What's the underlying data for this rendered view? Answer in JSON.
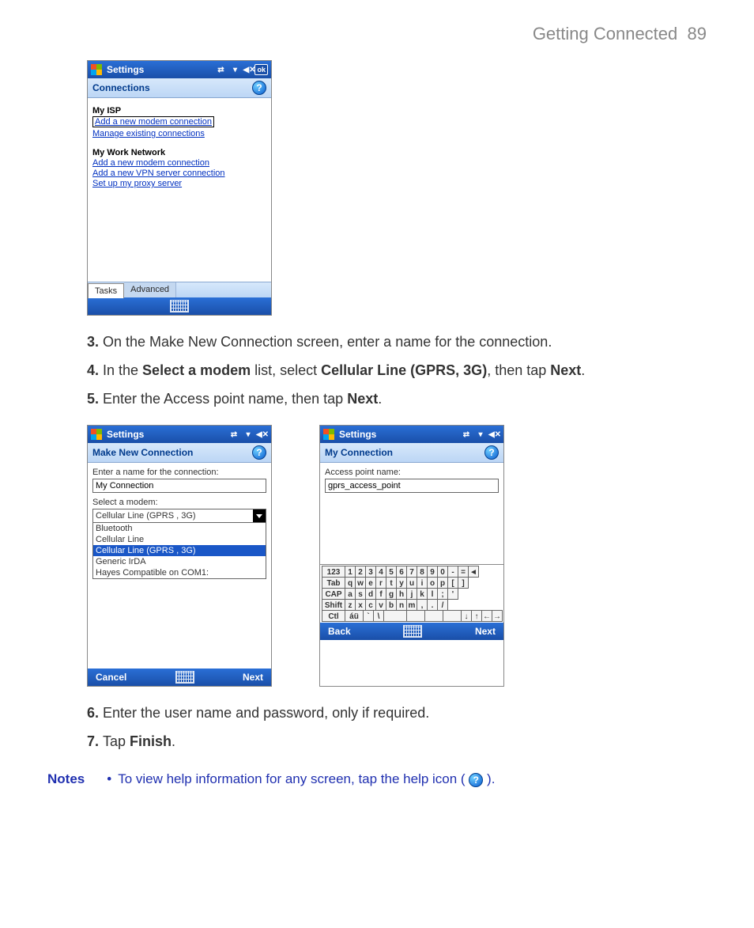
{
  "page_header": {
    "title": "Getting Connected",
    "number": "89"
  },
  "screenshot1": {
    "titlebar_label": "Settings",
    "ok_label": "ok",
    "subheader": "Connections",
    "isp_heading": "My ISP",
    "isp_links": {
      "add_modem": "Add a new modem connection",
      "manage": "Manage existing connections"
    },
    "work_heading": "My Work Network",
    "work_links": {
      "add_modem": "Add a new modem connection",
      "add_vpn": "Add a new VPN server connection",
      "proxy": "Set up my proxy server"
    },
    "tabs": {
      "tasks": "Tasks",
      "advanced": "Advanced"
    }
  },
  "instr": {
    "s3": "On the Make New Connection screen, enter a name for the connection.",
    "s4a": "In the ",
    "s4b": "Select a modem",
    "s4c": " list, select ",
    "s4d": "Cellular Line (GPRS, 3G)",
    "s4e": ", then tap ",
    "s4f": "Next",
    "s4g": ".",
    "s5a": "Enter the Access point name, then tap ",
    "s5b": "Next",
    "s5c": ".",
    "s6": "Enter the user name and password, only if required.",
    "s7a": "Tap ",
    "s7b": "Finish",
    "s7c": "."
  },
  "screenshot2": {
    "titlebar_label": "Settings",
    "subheader": "Make New Connection",
    "label_name": "Enter a name for the connection:",
    "name_value": "My Connection",
    "label_modem": "Select a modem:",
    "combo_selected": "Cellular Line (GPRS , 3G)",
    "options": [
      "Bluetooth",
      "Cellular Line",
      "Cellular Line (GPRS , 3G)",
      "Generic IrDA",
      "Hayes Compatible on COM1:"
    ],
    "btn_left": "Cancel",
    "btn_right": "Next"
  },
  "screenshot3": {
    "titlebar_label": "Settings",
    "subheader": "My Connection",
    "label_apn": "Access point name:",
    "apn_value": "gprs_access_point",
    "btn_left": "Back",
    "btn_right": "Next",
    "keyboard_rows": [
      [
        "123",
        "1",
        "2",
        "3",
        "4",
        "5",
        "6",
        "7",
        "8",
        "9",
        "0",
        "-",
        "=",
        "◄"
      ],
      [
        "Tab",
        "q",
        "w",
        "e",
        "r",
        "t",
        "y",
        "u",
        "i",
        "o",
        "p",
        "[",
        "]"
      ],
      [
        "CAP",
        "a",
        "s",
        "d",
        "f",
        "g",
        "h",
        "j",
        "k",
        "l",
        ";",
        "'"
      ],
      [
        "Shift",
        "z",
        "x",
        "c",
        "v",
        "b",
        "n",
        "m",
        ",",
        ".",
        "/"
      ],
      [
        "Ctl",
        "áü",
        "`",
        "\\",
        "",
        "",
        "",
        "",
        "↓",
        "↑",
        "←",
        "→"
      ]
    ]
  },
  "notes": {
    "label": "Notes",
    "text_a": "To view help information for any screen, tap the help icon ( ",
    "text_b": " )."
  }
}
